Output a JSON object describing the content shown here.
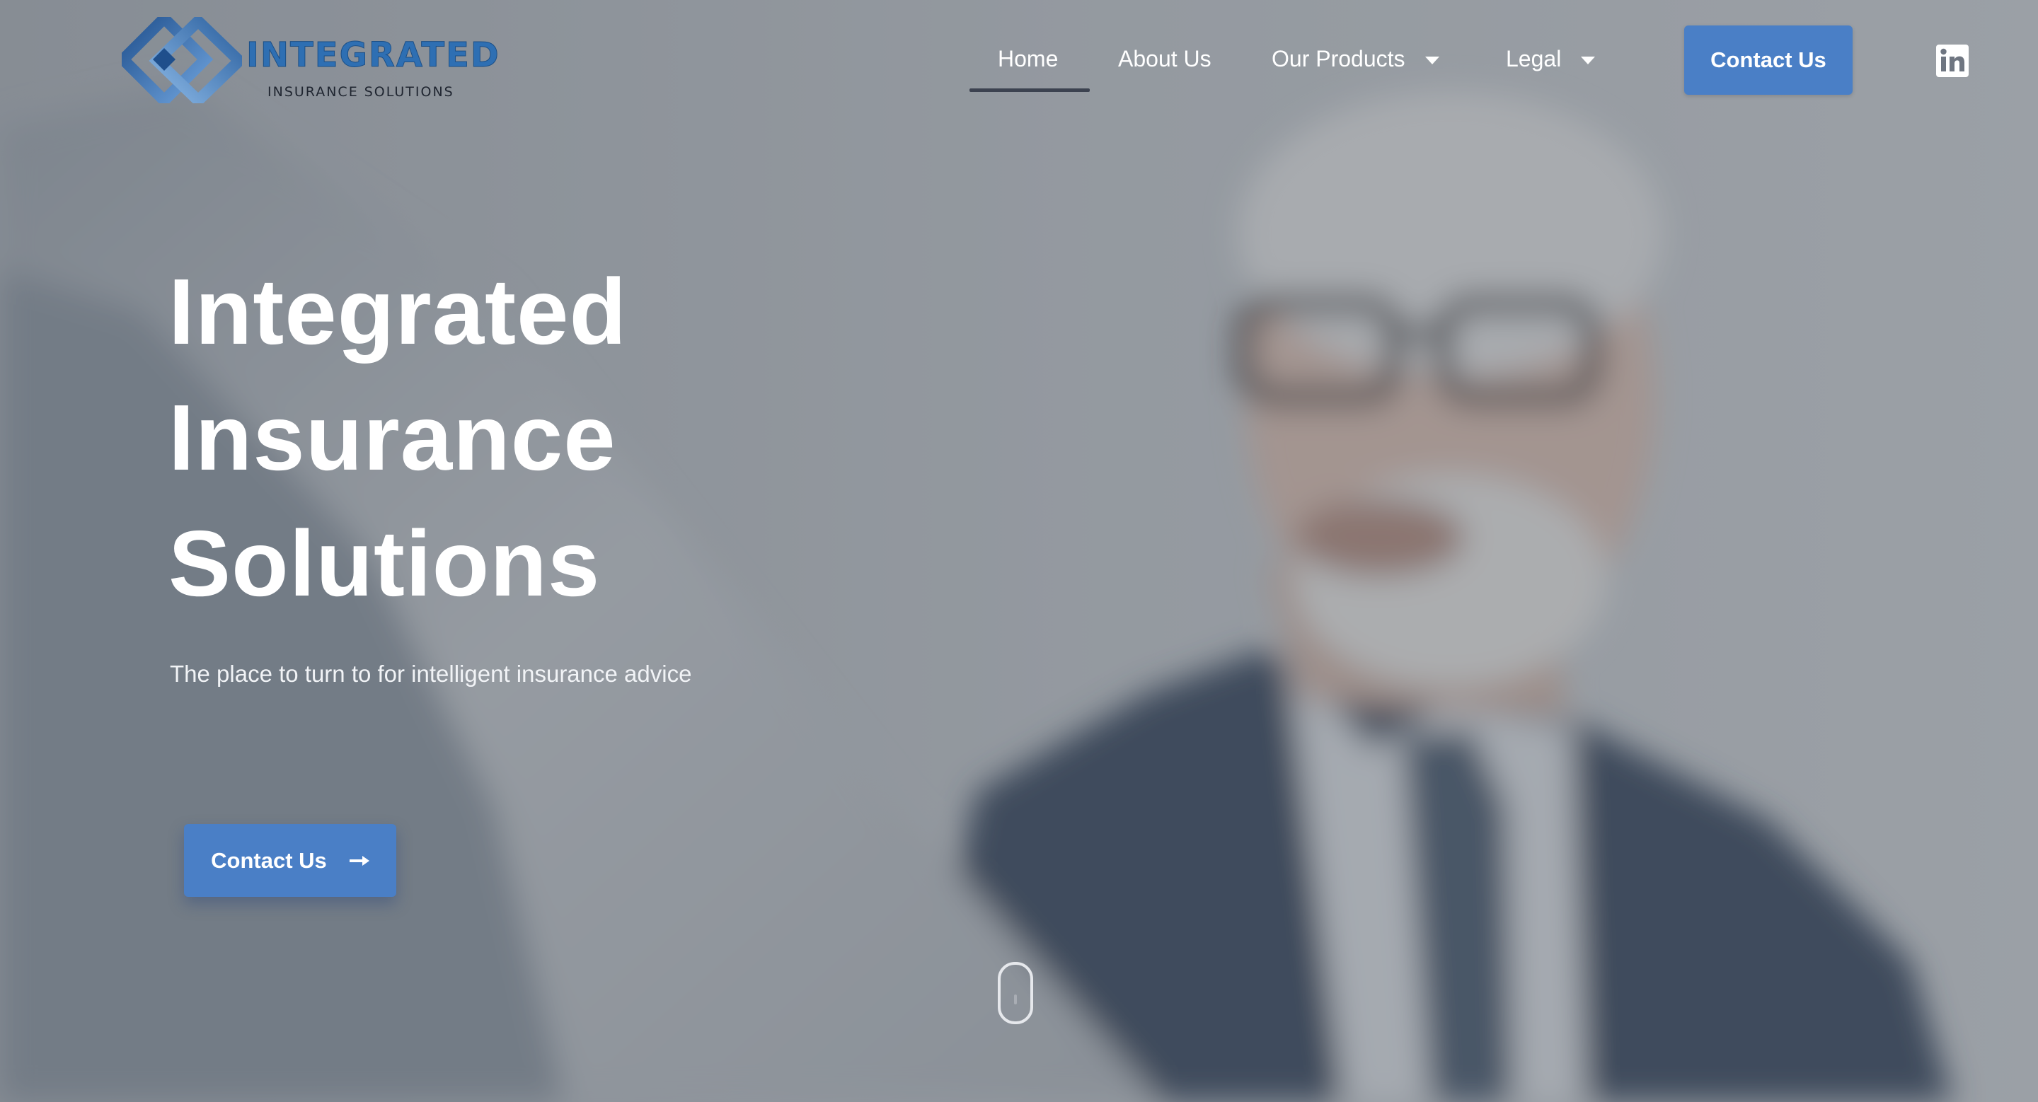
{
  "brand": {
    "name": "INTEGRATED",
    "tagline": "INSURANCE SOLUTIONS",
    "primary_color": "#2e6fb3",
    "accent_color": "#4a7fc6"
  },
  "nav": {
    "items": [
      {
        "label": "Home",
        "active": true
      },
      {
        "label": "About Us"
      },
      {
        "label": "Our Products",
        "has_dropdown": true
      },
      {
        "label": "Legal",
        "has_dropdown": true
      }
    ],
    "cta_label": "Contact Us",
    "social_icon": "linkedin-icon"
  },
  "hero": {
    "title_lines": [
      "Integrated",
      "Insurance",
      "Solutions"
    ],
    "subtitle": "The place to turn to for intelligent insurance advice",
    "cta_label": "Contact Us",
    "cta_icon": "arrow-right-icon",
    "scroll_icon": "scroll-mouse-icon"
  }
}
